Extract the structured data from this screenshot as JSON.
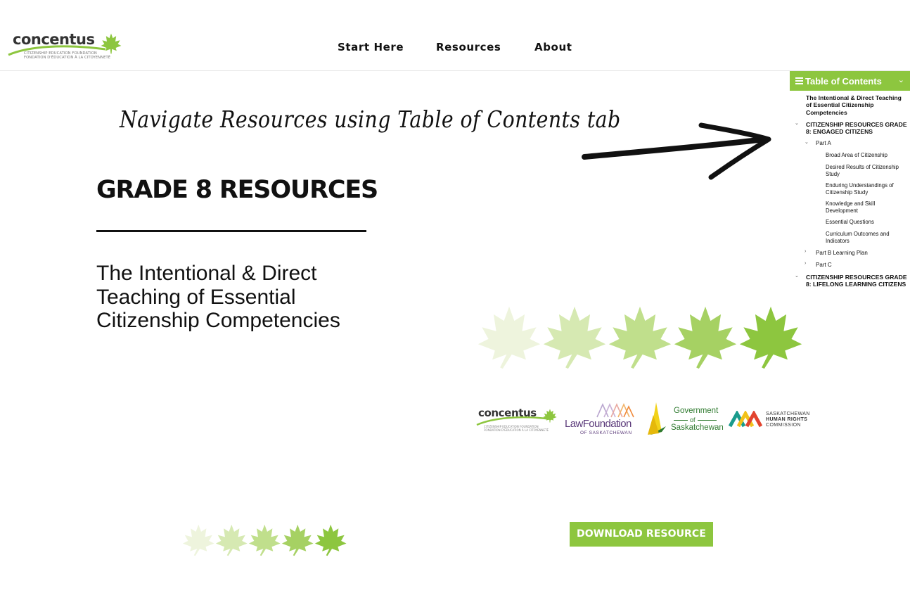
{
  "header": {
    "logo": {
      "name": "concentus",
      "subline1": "CITIZENSHIP EDUCATION FOUNDATION",
      "subline2": "FONDATION D'ÉDUCATION À LA CITOYENNETÉ"
    },
    "nav": [
      {
        "label": "Start Here"
      },
      {
        "label": "Resources"
      },
      {
        "label": "About"
      }
    ]
  },
  "annotation": {
    "text": "Navigate Resources using Table of Contents tab"
  },
  "main": {
    "title": "GRADE 8 RESOURCES",
    "subtitle": "The Intentional & Direct Teaching of Essential Citizenship Competencies",
    "download_label": "DOWNLOAD RESOURCE"
  },
  "partners": {
    "concentus": {
      "name": "concentus",
      "subline1": "CITIZENSHIP EDUCATION FOUNDATION",
      "subline2": "FONDATION D'ÉDUCATION À LA CITOYENNETÉ"
    },
    "law": {
      "name": "LawFoundation",
      "sub": "OF SASKATCHEWAN"
    },
    "gov": {
      "line1": "Government",
      "line2": "of",
      "line3": "Saskatchewan"
    },
    "shrc": {
      "line1": "SASKATCHEWAN",
      "line2": "HUMAN RIGHTS",
      "line3": "COMMISSION"
    }
  },
  "toc": {
    "title": "Table of Contents",
    "items": [
      {
        "label": "The Intentional & Direct Teaching of Essential Citizenship Competencies",
        "level": 1,
        "chevron": ""
      },
      {
        "label": "CITIZENSHIP RESOURCES GRADE 8: ENGAGED CITIZENS",
        "level": 1,
        "chevron": "⌄"
      },
      {
        "label": "Part A",
        "level": 2,
        "chevron": "⌄"
      },
      {
        "label": "Broad Area of Citizenship",
        "level": 3,
        "chevron": ""
      },
      {
        "label": "Desired Results of Citizenship Study",
        "level": 3,
        "chevron": ""
      },
      {
        "label": "Enduring Understandings of Citizenship Study",
        "level": 3,
        "chevron": ""
      },
      {
        "label": "Knowledge and Skill Development",
        "level": 3,
        "chevron": ""
      },
      {
        "label": "Essential Questions",
        "level": 3,
        "chevron": ""
      },
      {
        "label": "Curriculum Outcomes and Indicators",
        "level": 3,
        "chevron": ""
      },
      {
        "label": "Part B Learning Plan",
        "level": 2,
        "chevron": "›"
      },
      {
        "label": "Part C",
        "level": 2,
        "chevron": "›"
      },
      {
        "label": "CITIZENSHIP RESOURCES GRADE 8: LIFELONG LEARNING CITIZENS",
        "level": 1,
        "chevron": "⌄"
      }
    ]
  },
  "colors": {
    "accent_green": "#8dc63f",
    "text": "#111111"
  },
  "icons": {
    "toc_menu": "hamburger-icon",
    "toc_toggle": "chevron-down-icon",
    "arrow": "hand-drawn-arrow-icon",
    "leaf": "maple-leaf-icon"
  }
}
